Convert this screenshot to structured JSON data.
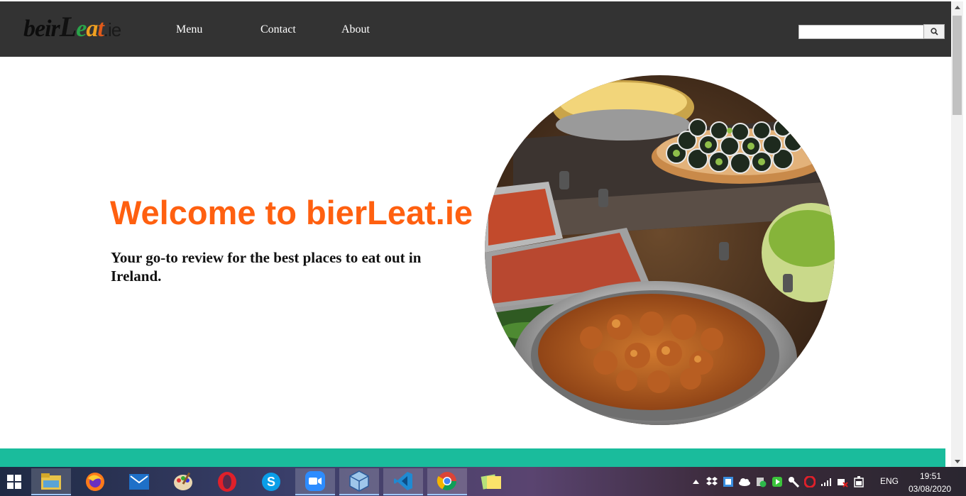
{
  "nav": {
    "logo": {
      "part1": "beir",
      "part2": "L",
      "e": "e",
      "a": "a",
      "t": "t",
      "suffix": ".ie"
    },
    "links": [
      {
        "label": "Menu"
      },
      {
        "label": "Contact"
      },
      {
        "label": "About"
      }
    ],
    "search": {
      "value": "",
      "placeholder": ""
    },
    "background": "#333333"
  },
  "hero": {
    "title": "Welcome to bierLeat.ie",
    "subtitle": "Your go-to review for the best places to eat out in Ireland.",
    "title_color": "#ff6010",
    "image": "food-buffet-photo"
  },
  "footer_band": {
    "color": "#1abc9c"
  },
  "taskbar": {
    "apps": [
      "windows-start",
      "file-explorer",
      "firefox",
      "mail",
      "paint",
      "opera",
      "skype",
      "zoom",
      "virtualbox",
      "vscode",
      "chrome",
      "sticky-notes"
    ],
    "language": "ENG",
    "time": "19:51",
    "date": "03/08/2020"
  }
}
